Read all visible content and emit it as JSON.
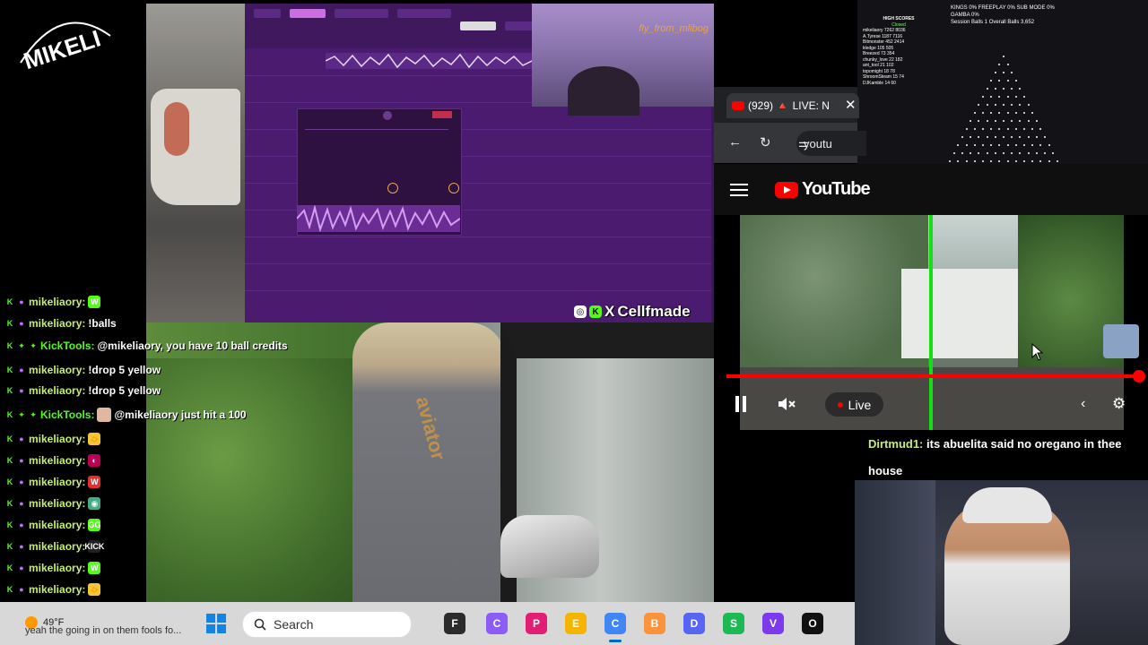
{
  "logo": {
    "text": "MIKELI"
  },
  "daw": {
    "cam_name": "fly_from_mlibog"
  },
  "cellfmade": {
    "ig": "◎",
    "kick": "K",
    "x": "X",
    "text": "Cellfmade"
  },
  "main_video": {
    "shirt_logo": "aviator"
  },
  "chat": {
    "messages": [
      {
        "user": "mikeliaory:",
        "text": "",
        "emote": "W",
        "emote_color": "#53fc18",
        "bot": false
      },
      {
        "user": "mikeliaory:",
        "text": "!balls",
        "emote": "",
        "bot": false
      },
      {
        "user": "KickTools:",
        "text": "@mikeliaory, you have 10 ball credits",
        "emote": "",
        "bot": true
      },
      {
        "user": "mikeliaory:",
        "text": "!drop 5 yellow",
        "emote": "",
        "bot": false
      },
      {
        "user": "mikeliaory:",
        "text": "!drop 5 yellow",
        "emote": "",
        "bot": false
      },
      {
        "user": "KickTools:",
        "text": "@mikeliaory just hit a 100",
        "emote": "",
        "bot": true
      },
      {
        "user": "mikeliaory:",
        "text": "",
        "emote": "🤝",
        "emote_color": "#f3c43c",
        "bot": false
      },
      {
        "user": "mikeliaory:",
        "text": "",
        "emote": "◐",
        "emote_color": "#b05",
        "bot": false
      },
      {
        "user": "mikeliaory:",
        "text": "",
        "emote": "W",
        "emote_color": "#e03030",
        "bot": false
      },
      {
        "user": "mikeliaory:",
        "text": "",
        "emote": "◉",
        "emote_color": "#4a8",
        "bot": false
      },
      {
        "user": "mikeliaory:",
        "text": "",
        "emote": "GG",
        "emote_color": "#53fc18",
        "bot": false
      },
      {
        "user": "mikeliaory:",
        "text": "",
        "emote": "KICK",
        "emote_color": "#222",
        "bot": false
      },
      {
        "user": "mikeliaory:",
        "text": "",
        "emote": "W",
        "emote_color": "#53fc18",
        "bot": false
      },
      {
        "user": "mikeliaory:",
        "text": "",
        "emote": "🤝",
        "emote_color": "#f3c43c",
        "bot": false
      }
    ],
    "ticker": "yeah the going in on them fools fo..."
  },
  "browser": {
    "tab_title": "(929) 🔺 LIVE: N",
    "url": "youtu",
    "close": "✕",
    "back": "←",
    "reload": "↻",
    "tune": "⚌"
  },
  "youtube": {
    "logo_text": "YouTube",
    "live_label": "Live"
  },
  "plinko": {
    "stats": "KINGS 0% FREEPLAY 0% SUB MODE 0% GAMBA 0%",
    "session": "Session Balls 1  Overall Balls 3,652",
    "high_scores_title": "HIGH SCORES",
    "status": "Closed",
    "scores": [
      "mikeliaory 7262 8036",
      "A.Tyrese 1187 7116",
      "Bitmonster 452 2414",
      "kledge 105 505",
      "Breezed 73 354",
      "chunky_love 22 182",
      "ant_tool 21 102",
      "topomight 18 78",
      "ShroomSteam 15 74",
      "DJKamble 14 60"
    ]
  },
  "comment": {
    "name": "Dirtmud1:",
    "text": "its abuelita said no oregano in thee house"
  },
  "taskbar": {
    "temp": "49°F",
    "search_placeholder": "Search",
    "icons": [
      "Files",
      "Copilot",
      "Paint",
      "Explorer",
      "Chrome",
      "Brave",
      "Discord",
      "Spotify",
      "VS",
      "OBS"
    ]
  },
  "colors": {
    "kick_green": "#53fc18",
    "yt_red": "#ff0000",
    "daw_purple": "#4a1b6e"
  }
}
